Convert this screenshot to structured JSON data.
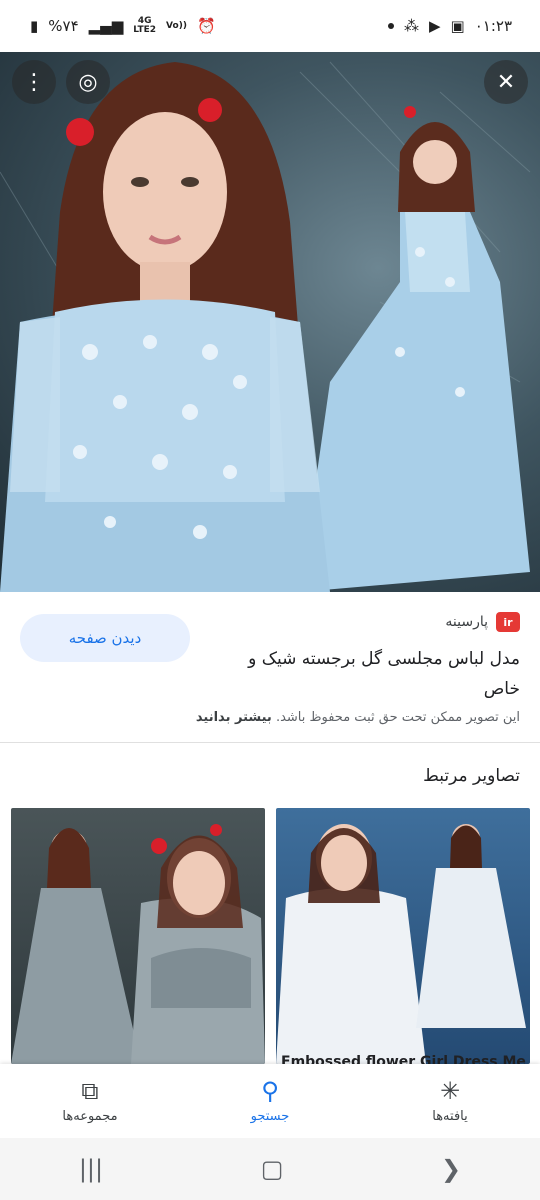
{
  "status_bar": {
    "time": "۰۱:۲۳",
    "battery": "%۷۴",
    "network_top": "4G",
    "network_bottom": "LTE2",
    "volte": "Vo))"
  },
  "hero": {
    "menu_icon": "more-vert-icon",
    "lens_icon": "lens-icon",
    "close_icon": "close-icon"
  },
  "result": {
    "source_logo_text": "ir",
    "source_name": "پارسینه",
    "title": "مدل لباس مجلسی گل برجسته شیک و خاص",
    "view_page_label": "دیدن صفحه",
    "copyright_text": "این تصویر ممکن تحت حق ثبت محفوظ باشد.",
    "learn_more": "بیشتر بدانید"
  },
  "related": {
    "title": "تصاویر مرتبط",
    "items": [
      {
        "caption": ""
      },
      {
        "caption": "Embossed flower Girl Dress Me"
      }
    ]
  },
  "bottom_nav": {
    "items": [
      {
        "label": "مجموعه‌ها",
        "icon": "bookmarks-icon"
      },
      {
        "label": "جستجو",
        "icon": "search-icon"
      },
      {
        "label": "یافته‌ها",
        "icon": "discover-icon"
      }
    ],
    "active_index": 1,
    "accent": "#1a73e8"
  },
  "system_nav": {
    "recents_icon": "recents-icon",
    "home_icon": "home-icon",
    "back_icon": "back-icon"
  }
}
